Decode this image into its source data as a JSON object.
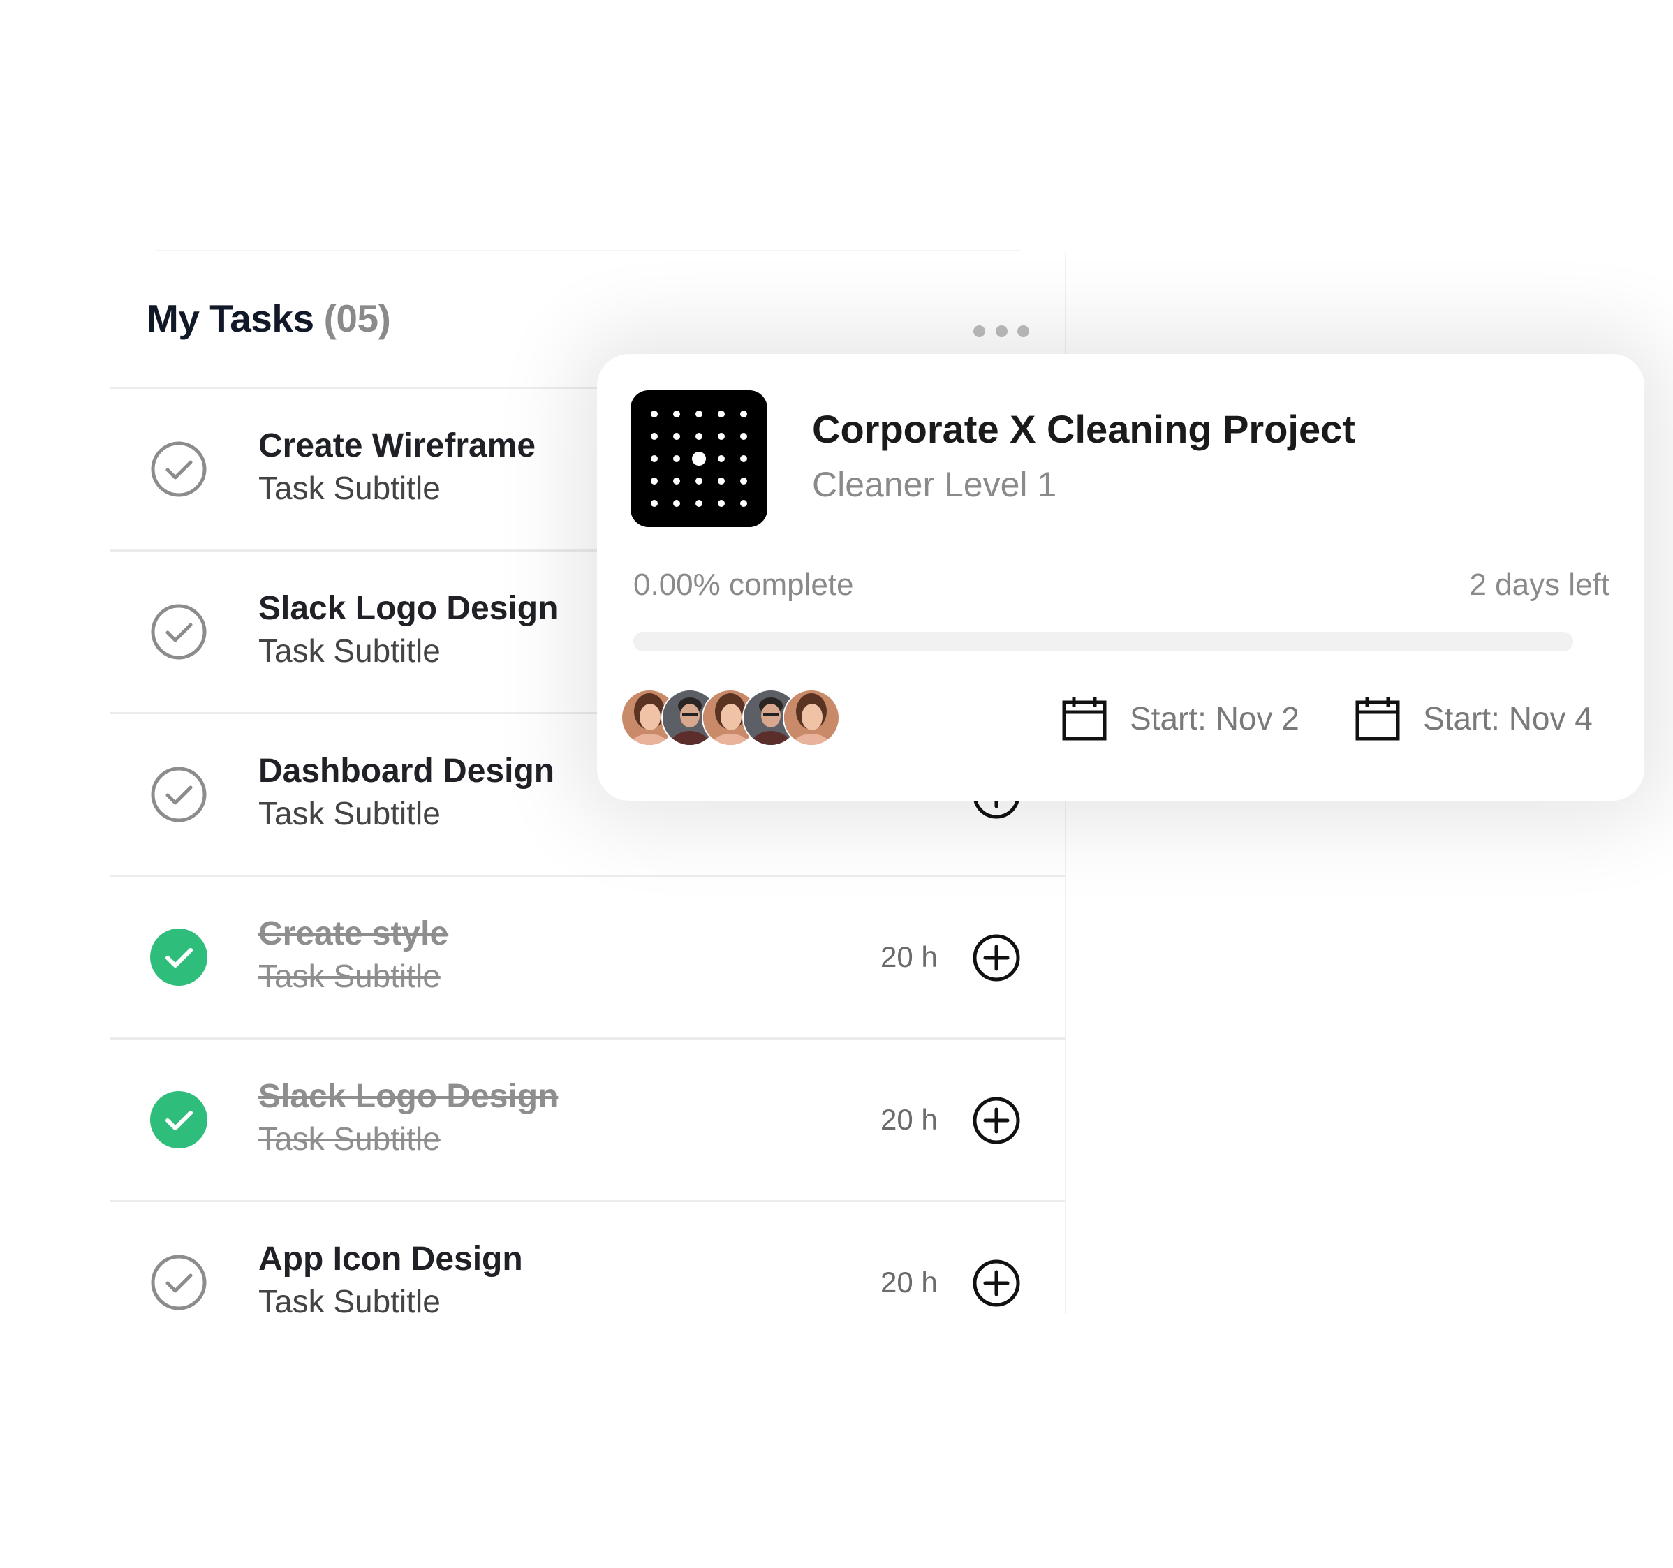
{
  "tasks": {
    "title": "My Tasks",
    "count": "(05)",
    "menu_icon": "more-horizontal-icon",
    "items": [
      {
        "title": "Create Wireframe",
        "subtitle": "Task Subtitle",
        "hours": "",
        "done": false
      },
      {
        "title": "Slack Logo Design",
        "subtitle": "Task Subtitle",
        "hours": "",
        "done": false
      },
      {
        "title": "Dashboard Design",
        "subtitle": "Task Subtitle",
        "hours": "",
        "done": false
      },
      {
        "title": "Create style",
        "subtitle": "Task Subtitle",
        "hours": "20 h",
        "done": true
      },
      {
        "title": "Slack Logo Design",
        "subtitle": "Task Subtitle",
        "hours": "20 h",
        "done": true
      },
      {
        "title": "App Icon Design",
        "subtitle": "Task Subtitle",
        "hours": "20 h",
        "done": false
      }
    ]
  },
  "project": {
    "title": "Corporate X Cleaning Project",
    "role": "Cleaner Level 1",
    "progress_label": "0.00% complete",
    "progress_fraction": 0.0,
    "days_left": "2 days left",
    "start_date": "Start: Nov 2",
    "end_date": "Start: Nov 4",
    "member_count": 5
  },
  "colors": {
    "done_green": "#2ebd7a",
    "check_outline": "#8c8c8c",
    "text_dark": "#1f2126",
    "text_muted": "#8a8a8a"
  }
}
